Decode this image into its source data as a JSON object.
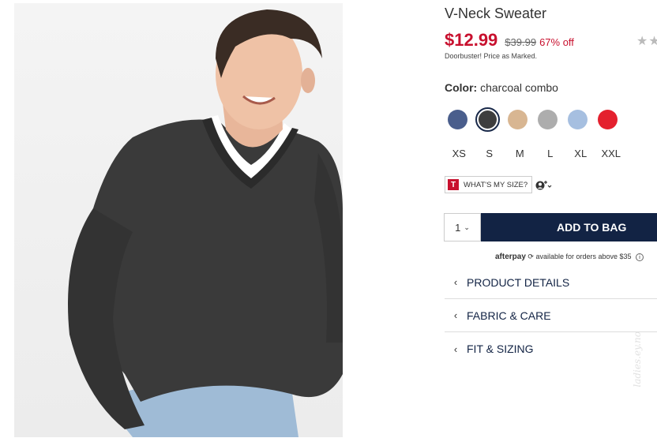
{
  "product": {
    "title": "V-Neck Sweater",
    "price": "$12.99",
    "original_price": "$39.99",
    "discount": "67% off",
    "promo_note": "Doorbuster! Price as Marked.",
    "rating_stars": "★★"
  },
  "color": {
    "label": "Color:",
    "value": "charcoal combo",
    "swatches": [
      {
        "name": "navy heather",
        "hex": "#4a5e8c"
      },
      {
        "name": "charcoal combo",
        "hex": "#3e3e3e",
        "selected": true
      },
      {
        "name": "camel",
        "hex": "#d8b692"
      },
      {
        "name": "grey",
        "hex": "#adadad"
      },
      {
        "name": "light blue",
        "hex": "#a6bfe0"
      },
      {
        "name": "red",
        "hex": "#e4202e"
      }
    ]
  },
  "sizes": [
    "XS",
    "S",
    "M",
    "L",
    "XL",
    "XXL"
  ],
  "size_help": {
    "badge": "T",
    "label": "WHAT'S MY SIZE?",
    "extra_icon": "user-plus-icon"
  },
  "cart": {
    "quantity": "1",
    "add_label": "ADD TO BAG"
  },
  "afterpay": {
    "brand": "afterpay",
    "text": "available for orders above $35"
  },
  "accordion": [
    {
      "label": "PRODUCT DETAILS",
      "icon": "chevron-left-icon"
    },
    {
      "label": "FABRIC & CARE",
      "icon": "chevron-left-icon"
    },
    {
      "label": "FIT & SIZING",
      "icon": "chevron-left-icon"
    }
  ],
  "watermark": "ladies.ey.no"
}
